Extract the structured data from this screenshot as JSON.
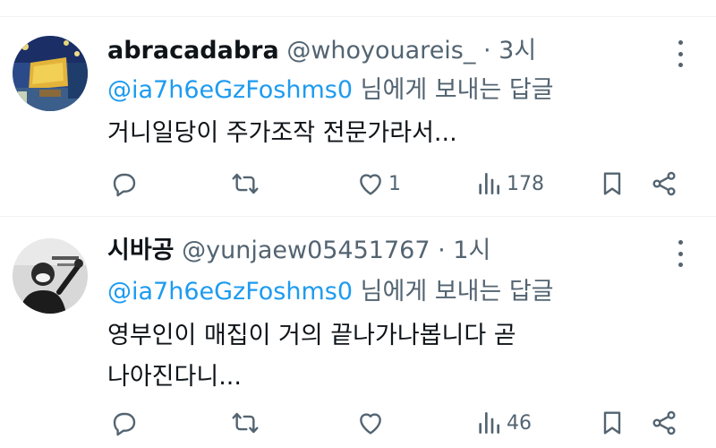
{
  "tweets": [
    {
      "display_name": "abracadabra",
      "handle": "@whoyouareis_",
      "separator": "·",
      "time": "3시",
      "reply_to_handle": "@ia7h6eGzFoshms0",
      "reply_to_suffix": "님에게 보내는 답글",
      "text_lines": [
        "거니일당이 주가조작 전문가라서..."
      ],
      "likes": "1",
      "views": "178",
      "avatar": "van-gogh-cafe-terrace-painting"
    },
    {
      "display_name": "시바공",
      "handle": "@yunjaew05451767",
      "separator": "·",
      "time": "1시",
      "reply_to_handle": "@ia7h6eGzFoshms0",
      "reply_to_suffix": "님에게 보내는 답글",
      "text_lines": [
        "영부인이 매집이 거의 끝나가나봅니다 곧",
        "나아진다니..."
      ],
      "likes": "",
      "views": "46",
      "avatar": "person-in-mask-photo"
    }
  ],
  "icons": {
    "reply": "reply-icon",
    "retweet": "retweet-icon",
    "like": "heart-icon",
    "views": "views-chart-icon",
    "bookmark": "bookmark-icon",
    "share": "share-icon",
    "more": "more-vertical-icon"
  },
  "colors": {
    "text": "#0f1419",
    "secondary": "#536471",
    "mention": "#1d9bf0",
    "divider": "#eff3f4"
  }
}
